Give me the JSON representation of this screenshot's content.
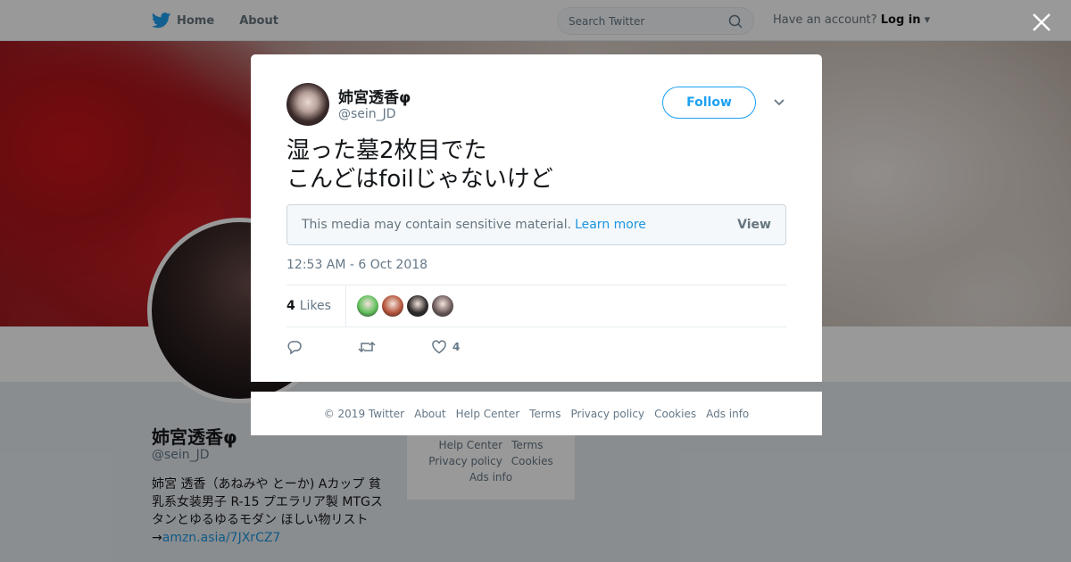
{
  "topbar": {
    "nav": [
      {
        "label": "Home",
        "icon": "twitter-bird-icon"
      },
      {
        "label": "About"
      }
    ],
    "search_placeholder": "Search Twitter",
    "account_prompt": "Have an account?",
    "login_label": "Log in"
  },
  "profile": {
    "name": "姉宮透香φ",
    "handle": "@sein_JD",
    "bio": "姉宮 透香（あねみや とーか) Aカップ 貧乳系女装男子 R-15 プエラリア製 MTGスタンとゆるゆるモダン ほしい物リスト→",
    "bio_link": "amzn.asia/7JXrCZ7"
  },
  "side_footer": {
    "links": [
      "Help Center",
      "Terms",
      "Privacy policy",
      "Cookies",
      "Ads info"
    ]
  },
  "tweet": {
    "author_name": "姉宮透香φ",
    "author_handle": "@sein_JD",
    "follow_label": "Follow",
    "text_line1": "湿った墓2枚目でた",
    "text_line2": "こんどはfoilじゃないけど",
    "media_warning": "This media may contain sensitive material.",
    "learn_more": "Learn more",
    "view_label": "View",
    "timestamp": "12:53 AM - 6 Oct 2018",
    "likes_count": "4",
    "likes_label": "Likes",
    "like_action_count": "4",
    "liker_colors": [
      "#5fbf5a",
      "#b4543a",
      "#2d2a2a",
      "#6b5a5a"
    ]
  },
  "footer": {
    "links": [
      "© 2019 Twitter",
      "About",
      "Help Center",
      "Terms",
      "Privacy policy",
      "Cookies",
      "Ads info"
    ]
  },
  "colors": {
    "accent": "#1da1f2",
    "link": "#1b95e0"
  }
}
